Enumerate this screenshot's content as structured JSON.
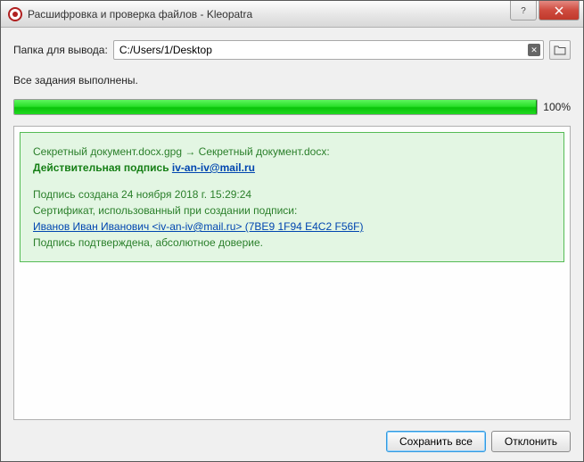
{
  "window": {
    "title": "Расшифровка и проверка файлов - Kleopatra"
  },
  "output": {
    "label": "Папка для вывода:",
    "path": "C:/Users/1/Desktop"
  },
  "status": "Все задания выполнены.",
  "progress": {
    "percent_text": "100%",
    "percent_value": 100
  },
  "result": {
    "filename_line": "Секретный документ.docx.gpg → Секретный документ.docx:",
    "valid_signature_prefix": "Действительная подпись ",
    "signer_email": "iv-an-iv@mail.ru",
    "created_line": "Подпись создана 24 ноября 2018 г. 15:29:24",
    "cert_prefix": "Сертификат, использованный при создании подписи:",
    "cert_link": "Иванов Иван Иванович <iv-an-iv@mail.ru> (7BE9 1F94 E4C2 F56F)",
    "trust_line": "Подпись подтверждена, абсолютное доверие."
  },
  "buttons": {
    "save_all": "Сохранить все",
    "reject": "Отклонить"
  }
}
